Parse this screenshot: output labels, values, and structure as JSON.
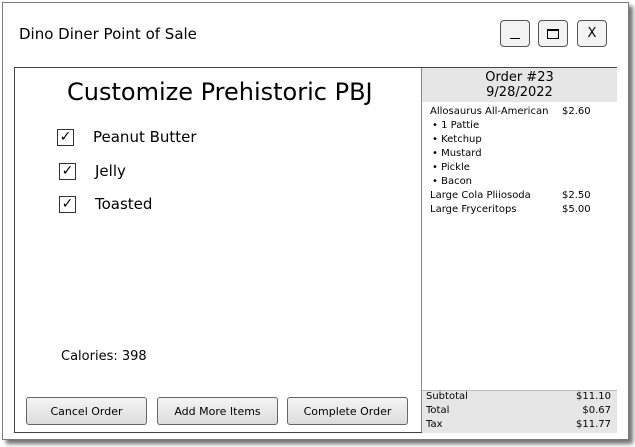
{
  "window": {
    "title": "Dino Diner Point of Sale",
    "controls": {
      "minimize": "_",
      "maximize": "□",
      "close": "X"
    }
  },
  "customize": {
    "heading": "Customize Prehistoric PBJ",
    "options": [
      {
        "label": "Peanut Butter",
        "checked": true
      },
      {
        "label": "Jelly",
        "checked": true
      },
      {
        "label": "Toasted",
        "checked": true
      }
    ],
    "check_glyph": "✓",
    "calories_label": "Calories: 398"
  },
  "buttons": {
    "cancel": "Cancel Order",
    "add_more": "Add More Items",
    "complete": "Complete Order"
  },
  "order": {
    "number": "Order #23",
    "date": "9/28/2022",
    "items": [
      {
        "name": "Allosaurus All-American",
        "price": "$2.60",
        "modifiers": [
          "• 1 Pattie",
          "• Ketchup",
          "• Mustard",
          "• Pickle",
          "• Bacon"
        ]
      },
      {
        "name": "Large Cola Pliiosoda",
        "price": "$2.50",
        "modifiers": []
      },
      {
        "name": "Large Fryceritops",
        "price": "$5.00",
        "modifiers": []
      }
    ],
    "totals": {
      "subtotal_label": "Subtotal",
      "subtotal": "$11.10",
      "total_label": "Total",
      "total": "$0.67",
      "tax_label": "Tax",
      "tax": "$11.77"
    }
  }
}
